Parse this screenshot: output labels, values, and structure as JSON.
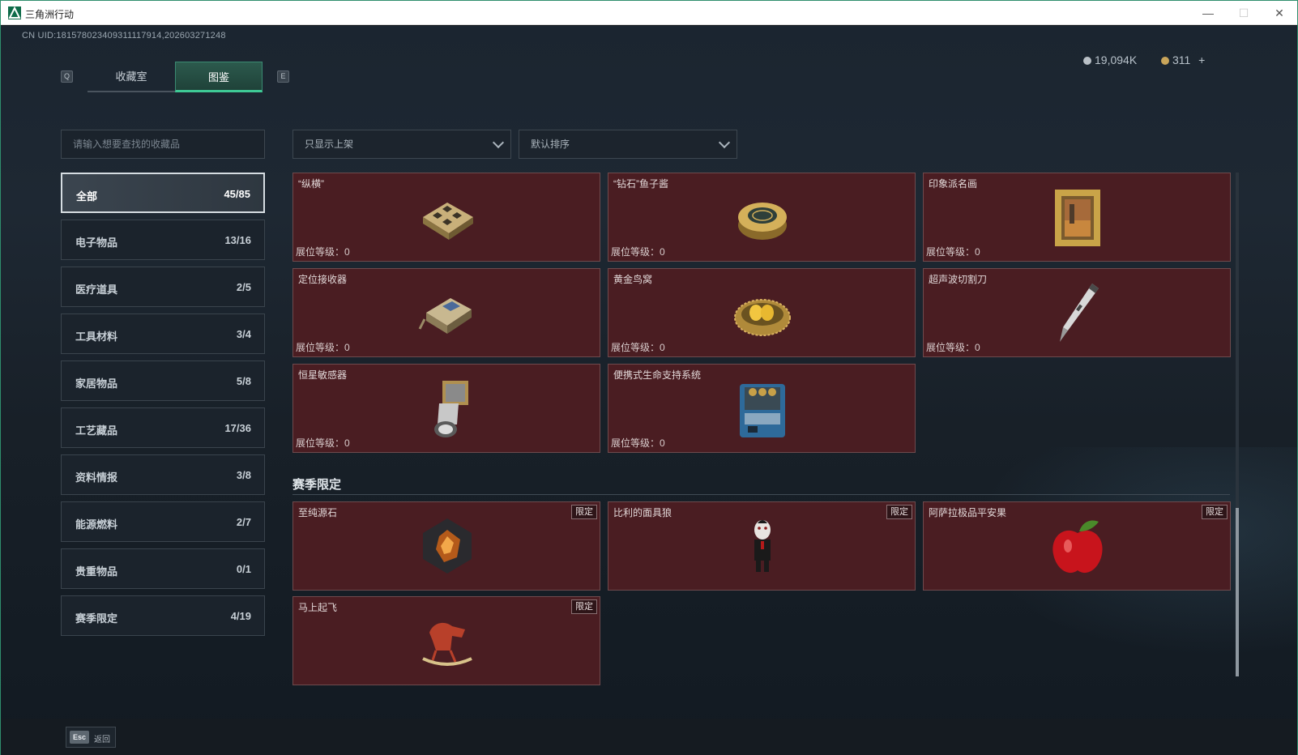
{
  "window": {
    "title": "三角洲行动",
    "controls": [
      "—",
      "☐",
      "✕"
    ]
  },
  "header": {
    "uid": "CN UID:181578023409311117914,202603271248",
    "left_key": "Q",
    "right_key": "E",
    "tabs": [
      "收藏室",
      "图鉴"
    ],
    "active_tab": "图鉴",
    "currency": {
      "silver": "19,094K",
      "gold": "311",
      "add": "+"
    }
  },
  "filters": {
    "search_placeholder": "请输入想要查找的收藏品",
    "dropdown1": "只显示上架",
    "dropdown2": "默认排序"
  },
  "categories": [
    {
      "label": "全部",
      "count": "45/85",
      "active": true
    },
    {
      "label": "电子物品",
      "count": "13/16"
    },
    {
      "label": "医疗道具",
      "count": "2/5"
    },
    {
      "label": "工具材料",
      "count": "3/4"
    },
    {
      "label": "家居物品",
      "count": "5/8"
    },
    {
      "label": "工艺藏品",
      "count": "17/36"
    },
    {
      "label": "资料情报",
      "count": "3/8"
    },
    {
      "label": "能源燃料",
      "count": "2/7"
    },
    {
      "label": "贵重物品",
      "count": "0/1"
    },
    {
      "label": "赛季限定",
      "count": "4/19"
    }
  ],
  "items": [
    {
      "name": "“纵横”",
      "level": "展位等级：0",
      "icon": "chessboard-icon"
    },
    {
      "name": "“钻石”鱼子酱",
      "level": "展位等级：0",
      "icon": "caviar-tin-icon"
    },
    {
      "name": "印象派名画",
      "level": "展位等级：0",
      "icon": "framed-painting-icon"
    },
    {
      "name": "定位接收器",
      "level": "展位等级：0",
      "icon": "locator-receiver-icon"
    },
    {
      "name": "黄金鸟窝",
      "level": "展位等级：0",
      "icon": "golden-nest-icon"
    },
    {
      "name": "超声波切割刀",
      "level": "展位等级：0",
      "icon": "ultrasonic-cutter-icon"
    },
    {
      "name": "恒星敏感器",
      "level": "展位等级：0",
      "icon": "star-sensor-icon"
    },
    {
      "name": "便携式生命支持系统",
      "level": "展位等级：0",
      "icon": "life-support-icon"
    }
  ],
  "season_section": {
    "title": "赛季限定",
    "items": [
      {
        "name": "至纯源石",
        "badge": "限定",
        "icon": "source-stone-icon"
      },
      {
        "name": "比利的面具狼",
        "badge": "限定",
        "icon": "puppet-doll-icon"
      },
      {
        "name": "阿萨拉极品平安果",
        "badge": "限定",
        "icon": "apple-icon"
      },
      {
        "name": "马上起飞",
        "badge": "限定",
        "icon": "rocking-horse-icon"
      }
    ]
  },
  "footer": {
    "esc_key": "Esc",
    "esc_label": "返回"
  },
  "colors": {
    "accent": "#3ec995",
    "card_bg": "#4a1d22",
    "card_border": "#6e4a4d"
  }
}
